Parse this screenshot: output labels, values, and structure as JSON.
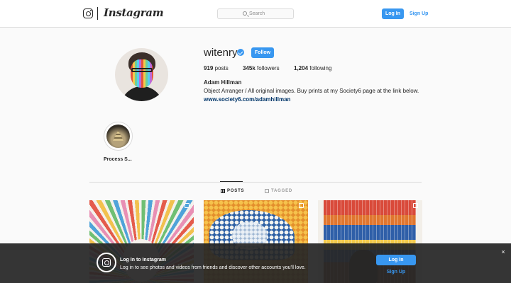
{
  "header": {
    "wordmark": "Instagram",
    "search_placeholder": "Search",
    "login_label": "Log In",
    "signup_label": "Sign Up"
  },
  "profile": {
    "username": "witenry",
    "verified": true,
    "follow_label": "Follow",
    "stats": {
      "posts_count": "919",
      "posts_label": "posts",
      "followers_count": "345k",
      "followers_label": "followers",
      "following_count": "1,204",
      "following_label": "following"
    },
    "full_name": "Adam Hillman",
    "bio": "Object Arranger / All original images. Buy prints at my Society6 page at the link below.",
    "website": "www.society6.com/adamhillman"
  },
  "highlights": [
    {
      "label": "Process S..."
    }
  ],
  "tabs": [
    {
      "label": "POSTS",
      "icon": "grid-icon",
      "active": true
    },
    {
      "label": "TAGGED",
      "icon": "tag-icon",
      "active": false
    }
  ],
  "posts": [
    {
      "subject": "rainbow-rays-artwork",
      "icon": "multi-photo-icon"
    },
    {
      "subject": "great-wave-beads-artwork",
      "icon": "multi-photo-icon"
    },
    {
      "subject": "paperclip-scream-artwork",
      "icon": "multi-photo-icon"
    }
  ],
  "login_banner": {
    "title": "Log In to Instagram",
    "text": "Log in to see photos and videos from friends and discover other accounts you'll love.",
    "login_label": "Log In",
    "signup_label": "Sign Up",
    "close_symbol": "×"
  },
  "colors": {
    "accent": "#3897f0",
    "link": "#003569",
    "banner_bg": "#262626",
    "page_bg": "#fafafa"
  }
}
